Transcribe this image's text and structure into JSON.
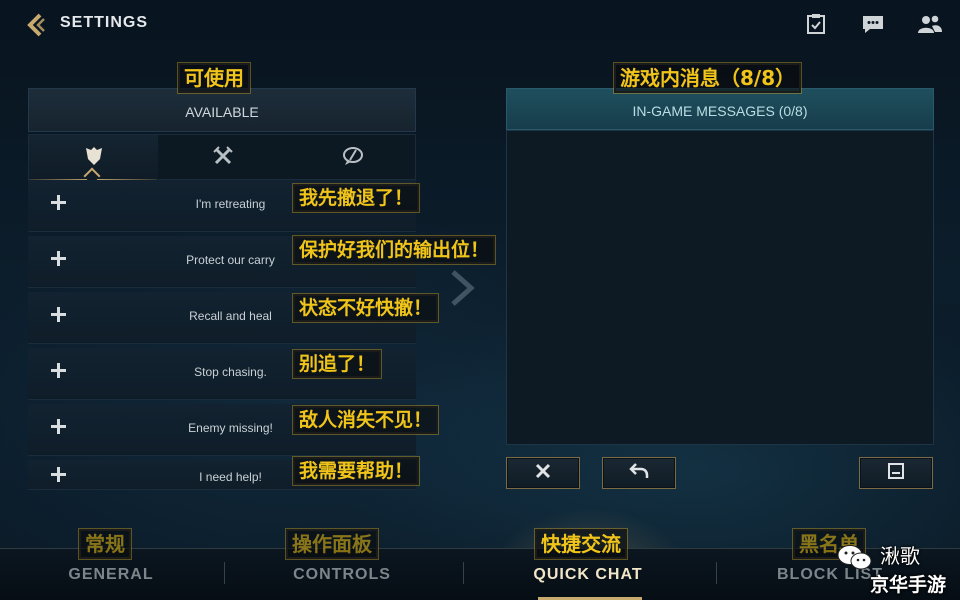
{
  "topbar": {
    "title": "SETTINGS",
    "icons": [
      "back-chevron-icon",
      "clipboard-icon",
      "chat-bubble-icon",
      "friends-icon"
    ]
  },
  "annotations": {
    "available": "可使用",
    "in_game": "游戏内消息（8/8）",
    "general": "常规",
    "controls": "操作面板",
    "quick_chat": "快捷交流",
    "block_list": "黑名单"
  },
  "available_panel": {
    "header": "AVAILABLE",
    "tabs": [
      {
        "icon": "shield-icon",
        "active": true
      },
      {
        "icon": "crossed-swords-icon",
        "active": false
      },
      {
        "icon": "no-chat-icon",
        "active": false
      }
    ],
    "messages": [
      {
        "label": "I'm retreating",
        "cn": "我先撤退了！"
      },
      {
        "label": "Protect our carry",
        "cn": "保护好我们的输出位！"
      },
      {
        "label": "Recall and heal",
        "cn": "状态不好快撤！"
      },
      {
        "label": "Stop chasing.",
        "cn": "别追了！"
      },
      {
        "label": "Enemy missing!",
        "cn": "敌人消失不见！"
      },
      {
        "label": "I need help!",
        "cn": "我需要帮助！"
      }
    ]
  },
  "ingame_panel": {
    "header": "IN-GAME MESSAGES (0/8)",
    "actions": [
      "close-icon",
      "undo-icon",
      "save-icon"
    ]
  },
  "bottom_nav": {
    "items": [
      {
        "label": "GENERAL",
        "active": false
      },
      {
        "label": "CONTROLS",
        "active": false
      },
      {
        "label": "QUICK CHAT",
        "active": true
      },
      {
        "label": "BLOCK LIST",
        "active": false
      }
    ]
  },
  "watermark": {
    "name": "湫歌",
    "sub": "京华手游"
  },
  "colors": {
    "gold": "#c8aa6e",
    "annotation_yellow": "#f0c419",
    "teal_header": "#1f4f5e"
  }
}
